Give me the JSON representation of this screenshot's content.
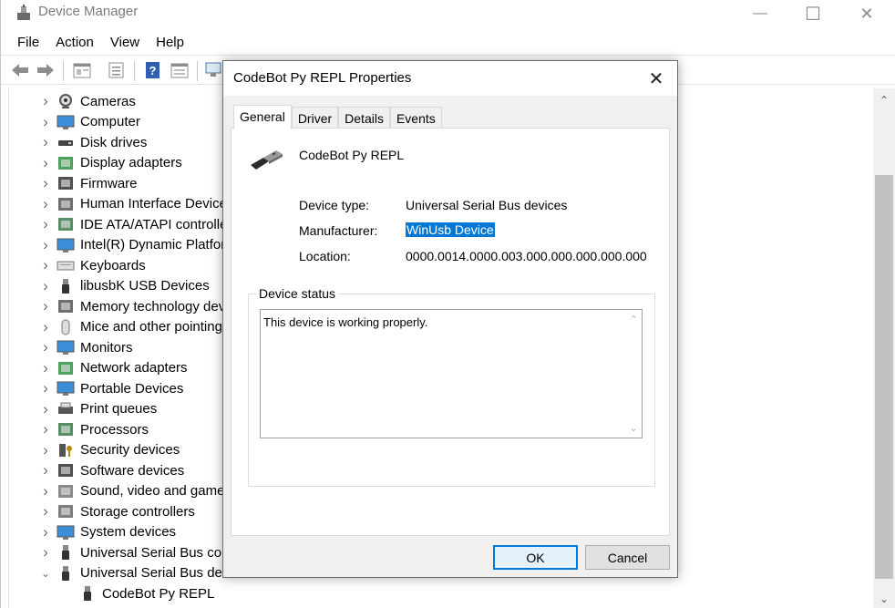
{
  "window": {
    "title": "Device Manager",
    "controls": {
      "minimize": "—",
      "maximize": "☐",
      "close": "✕"
    }
  },
  "menu": [
    "File",
    "Action",
    "View",
    "Help"
  ],
  "toolbar": [
    "back-icon",
    "forward-icon",
    "properties-icon",
    "update-icon",
    "help-icon",
    "view-icon",
    "scan-icon"
  ],
  "tree": {
    "items": [
      {
        "label": "Cameras",
        "icon": "camera-icon",
        "expanded": false
      },
      {
        "label": "Computer",
        "icon": "computer-icon",
        "expanded": false
      },
      {
        "label": "Disk drives",
        "icon": "disk-drive-icon",
        "expanded": false
      },
      {
        "label": "Display adapters",
        "icon": "display-adapter-icon",
        "expanded": false
      },
      {
        "label": "Firmware",
        "icon": "firmware-icon",
        "expanded": false
      },
      {
        "label": "Human Interface Devices",
        "icon": "hid-icon",
        "expanded": false
      },
      {
        "label": "IDE ATA/ATAPI controllers",
        "icon": "ide-icon",
        "expanded": false
      },
      {
        "label": "Intel(R) Dynamic Platform",
        "icon": "platform-icon",
        "expanded": false
      },
      {
        "label": "Keyboards",
        "icon": "keyboard-icon",
        "expanded": false
      },
      {
        "label": "libusbK USB Devices",
        "icon": "usb-plug-icon",
        "expanded": false
      },
      {
        "label": "Memory technology dev",
        "icon": "memory-icon",
        "expanded": false
      },
      {
        "label": "Mice and other pointing",
        "icon": "mouse-icon",
        "expanded": false
      },
      {
        "label": "Monitors",
        "icon": "monitor-icon",
        "expanded": false
      },
      {
        "label": "Network adapters",
        "icon": "network-icon",
        "expanded": false
      },
      {
        "label": "Portable Devices",
        "icon": "portable-icon",
        "expanded": false
      },
      {
        "label": "Print queues",
        "icon": "printer-icon",
        "expanded": false
      },
      {
        "label": "Processors",
        "icon": "processor-icon",
        "expanded": false
      },
      {
        "label": "Security devices",
        "icon": "security-icon",
        "expanded": false
      },
      {
        "label": "Software devices",
        "icon": "software-icon",
        "expanded": false
      },
      {
        "label": "Sound, video and game",
        "icon": "sound-icon",
        "expanded": false
      },
      {
        "label": "Storage controllers",
        "icon": "storage-icon",
        "expanded": false
      },
      {
        "label": "System devices",
        "icon": "system-icon",
        "expanded": false
      },
      {
        "label": "Universal Serial Bus cont",
        "icon": "usb-plug-icon",
        "expanded": false
      },
      {
        "label": "Universal Serial Bus devi",
        "icon": "usb-plug-icon",
        "expanded": true
      }
    ],
    "child": {
      "label": "CodeBot Py REPL",
      "icon": "usb-plug-icon"
    },
    "chevrons": {
      "collapsed": "›",
      "expanded": "⌄"
    }
  },
  "dialog": {
    "title": "CodeBot Py REPL Properties",
    "tabs": [
      "General",
      "Driver",
      "Details",
      "Events"
    ],
    "active_tab": "General",
    "device_name": "CodeBot Py REPL",
    "props": {
      "device_type_label": "Device type:",
      "device_type_value": "Universal Serial Bus devices",
      "manufacturer_label": "Manufacturer:",
      "manufacturer_value": "WinUsb Device",
      "location_label": "Location:",
      "location_value": "0000.0014.0000.003.000.000.000.000.000"
    },
    "status_legend": "Device status",
    "status_text": "This device is working properly.",
    "ok_label": "OK",
    "cancel_label": "Cancel"
  },
  "colors": {
    "selection": "#0078d7",
    "default_button_border": "#0078d7",
    "scrollbar_thumb": "#c2c2c2"
  }
}
